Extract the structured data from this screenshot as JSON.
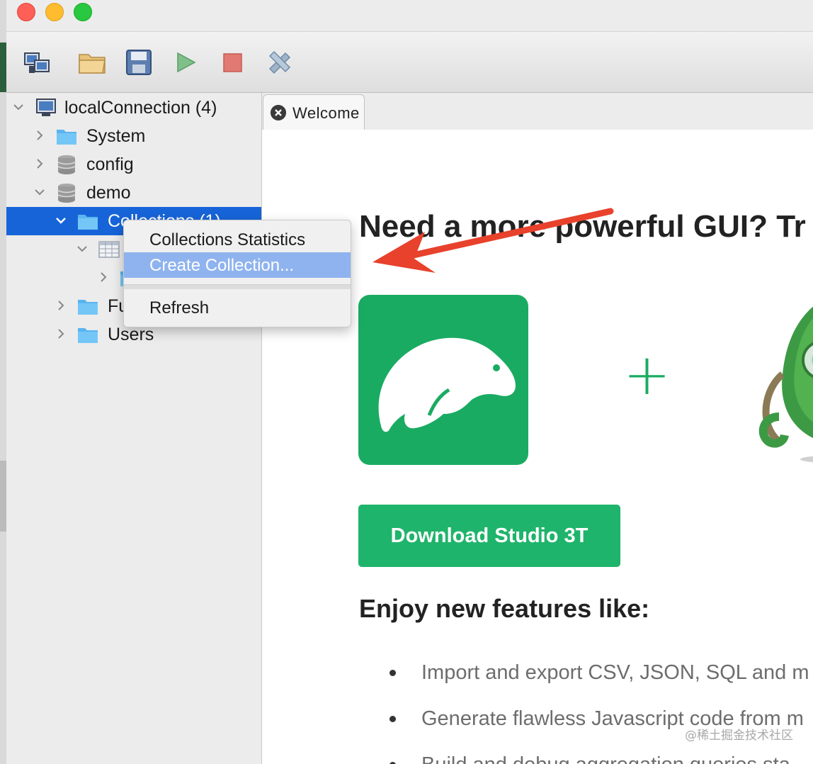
{
  "window": {
    "traffic_lights": {
      "close": "#fe5f57",
      "minimize": "#febc2e",
      "zoom": "#28c840"
    }
  },
  "toolbar": {
    "icons": [
      "connect-icon",
      "open-folder-icon",
      "save-icon",
      "run-icon",
      "stop-icon",
      "tools-icon"
    ]
  },
  "tree": {
    "connection": "localConnection (4)",
    "databases": {
      "system": "System",
      "config": "config",
      "demo": "demo",
      "collections": "Collections (1)",
      "functions": "Fu",
      "users": "Users"
    }
  },
  "tabs": [
    {
      "label": "Welcome"
    }
  ],
  "welcome": {
    "headline": "Need a more powerful GUI? Tr",
    "plus": "+",
    "download_button": "Download Studio 3T",
    "features_title": "Enjoy new features like:",
    "features": [
      "Import and export CSV, JSON, SQL and m",
      "Generate flawless Javascript code from m",
      "Build and debug aggregation queries sta"
    ]
  },
  "context_menu": {
    "items": [
      "Collections Statistics",
      "Create Collection...",
      "Refresh"
    ],
    "highlighted": "Create Collection..."
  },
  "watermark": "@稀土掘金技术社区",
  "colors": {
    "selection": "#1764d8",
    "brand_green": "#1aab62",
    "arrow_red": "#e8412c",
    "menu_highlight": "#8fb3ef"
  }
}
